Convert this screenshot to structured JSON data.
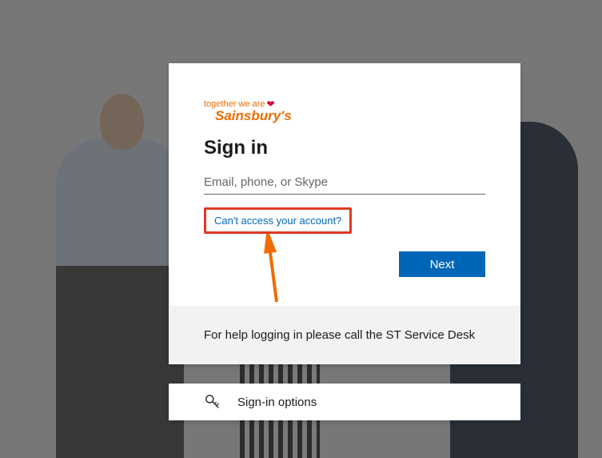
{
  "logo": {
    "top_text": "together we are",
    "main_text": "Sainsbury's"
  },
  "title": "Sign in",
  "input": {
    "placeholder": "Email, phone, or Skype",
    "value": ""
  },
  "access_link": "Can't access your account?",
  "next_button": "Next",
  "help_text": "For help logging in please call the ST Service Desk",
  "signin_options_label": "Sign-in options"
}
